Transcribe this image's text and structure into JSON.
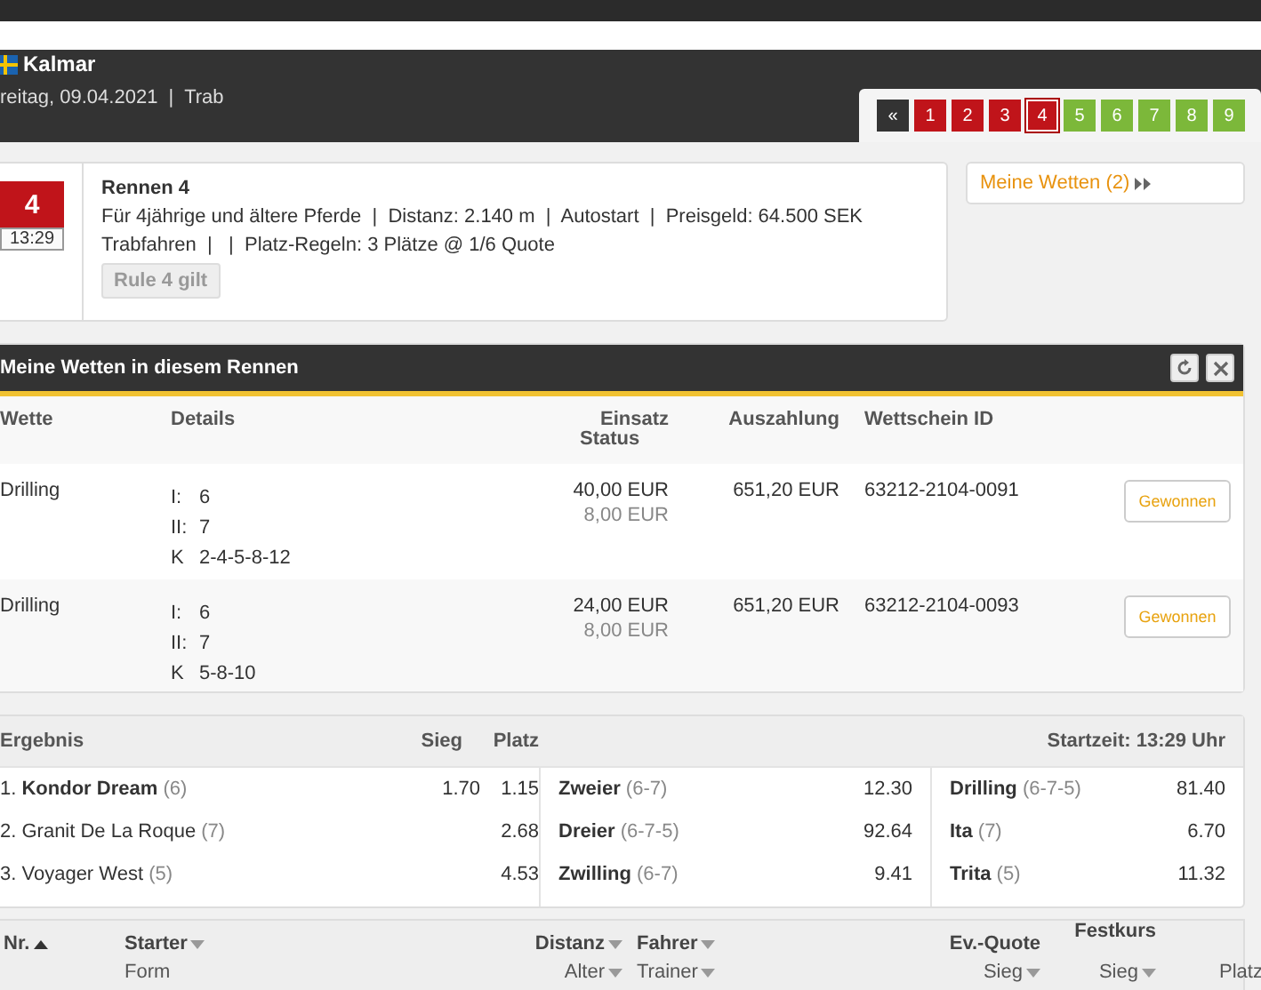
{
  "header": {
    "venue": "Kalmar",
    "subtitle": "reitag, 09.04.2021  |  Trab"
  },
  "race_nav": [
    {
      "label": "«",
      "kind": "back",
      "selected": false
    },
    {
      "label": "1",
      "kind": "finished",
      "selected": false
    },
    {
      "label": "2",
      "kind": "finished",
      "selected": false
    },
    {
      "label": "3",
      "kind": "finished",
      "selected": false
    },
    {
      "label": "4",
      "kind": "finished",
      "selected": true
    },
    {
      "label": "5",
      "kind": "open",
      "selected": false
    },
    {
      "label": "6",
      "kind": "open",
      "selected": false
    },
    {
      "label": "7",
      "kind": "open",
      "selected": false
    },
    {
      "label": "8",
      "kind": "open",
      "selected": false
    },
    {
      "label": "9",
      "kind": "open",
      "selected": false
    }
  ],
  "race": {
    "number": "4",
    "time": "13:29",
    "title": "Rennen 4",
    "line_1": "Für 4jährige und ältere Pferde  |  Distanz: 2.140 m  |  Autostart  |  Preisgeld: 64.500 SEK",
    "line_2": "Trabfahren  |   |  Platz-Regeln: 3 Plätze @ 1/6 Quote",
    "rule_badge": "Rule 4 gilt"
  },
  "my_bets_link": "Meine Wetten (2)",
  "bets_panel": {
    "title": "Meine Wetten in diesem Rennen",
    "columns": {
      "wette": "Wette",
      "details": "Details",
      "einsatz": "Einsatz",
      "status": "Status",
      "auszahlung": "Auszahlung",
      "ticket": "Wettschein ID"
    },
    "rows": [
      {
        "wette": "Drilling",
        "details": [
          {
            "key": "I:",
            "value": "6"
          },
          {
            "key": "II:",
            "value": "7"
          },
          {
            "key": "K",
            "value": "2-4-5-8-12"
          }
        ],
        "einsatz": "40,00 EUR",
        "einsatz_2": "8,00 EUR",
        "auszahlung": "651,20 EUR",
        "ticket": "63212-2104-0091",
        "status": "Gewonnen"
      },
      {
        "wette": "Drilling",
        "details": [
          {
            "key": "I:",
            "value": "6"
          },
          {
            "key": "II:",
            "value": "7"
          },
          {
            "key": "K",
            "value": "5-8-10"
          }
        ],
        "einsatz": "24,00 EUR",
        "einsatz_2": "8,00 EUR",
        "auszahlung": "651,20 EUR",
        "ticket": "63212-2104-0093",
        "status": "Gewonnen"
      }
    ]
  },
  "result": {
    "columns": {
      "ergebnis": "Ergebnis",
      "sieg": "Sieg",
      "platz": "Platz"
    },
    "start_time": "Startzeit: 13:29 Uhr",
    "finishers": [
      {
        "text": "1. **Kondor Dream**",
        "number": "(6)",
        "sieg": "1.70",
        "platz": "1.15"
      },
      {
        "text": "2. Granit De La Roque",
        "number": "(7)",
        "platz": "2.68"
      },
      {
        "text": "3. Voyager West",
        "number": "(5)",
        "platz": "4.53"
      }
    ],
    "payouts_1": [
      {
        "bet": "Zweier",
        "combo": "(6-7)",
        "value": "12.30"
      },
      {
        "bet": "Dreier",
        "combo": "(6-7-5)",
        "value": "92.64"
      },
      {
        "bet": "Zwilling",
        "combo": "(6-7)",
        "value": "9.41"
      }
    ],
    "payouts_2": [
      {
        "bet": "Drilling",
        "combo": "(6-7-5)",
        "value": "81.40"
      },
      {
        "bet": "Ita",
        "combo": "(7)",
        "value": "6.70"
      },
      {
        "bet": "Trita",
        "combo": "(5)",
        "value": "11.32"
      }
    ]
  },
  "starter_table": {
    "nr": "Nr.",
    "starter": "Starter",
    "form": "Form",
    "distanz": "Distanz",
    "alter": "Alter",
    "fahrer": "Fahrer",
    "trainer": "Trainer",
    "ev_quote": "Ev.-Quote",
    "ev_sieg": "Sieg",
    "festkurs": "Festkurs",
    "fk_sieg": "Sieg",
    "fk_platz": "Platz"
  }
}
